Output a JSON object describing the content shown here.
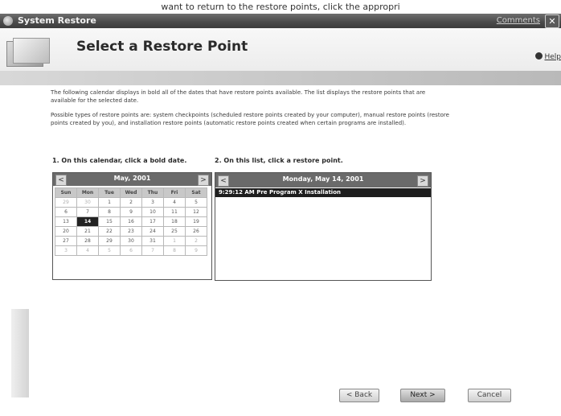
{
  "top_fragment": "want to return to the restore points, click the appropri",
  "window": {
    "title": "System Restore",
    "comments_link": "Comments",
    "close_glyph": "✕"
  },
  "header": {
    "page_title": "Select a Restore Point",
    "help_label": "Help"
  },
  "intro": {
    "para1": "The following calendar displays in bold all of the dates that have restore points available. The list displays the restore points that are available for the selected date.",
    "para2": "Possible types of restore points are: system checkpoints (scheduled restore points created by your computer), manual restore points (restore points created by you), and installation restore points (automatic restore points created when certain programs are installed)."
  },
  "steps": {
    "calendar_step": "1. On this calendar, click a bold date.",
    "list_step": "2. On this list, click a restore point."
  },
  "calendar": {
    "month_label": "May, 2001",
    "prev_glyph": "<",
    "next_glyph": ">",
    "weekdays": [
      "Sun",
      "Mon",
      "Tue",
      "Wed",
      "Thu",
      "Fri",
      "Sat"
    ],
    "weeks": [
      [
        "29",
        "30",
        "1",
        "2",
        "3",
        "4",
        "5"
      ],
      [
        "6",
        "7",
        "8",
        "9",
        "10",
        "11",
        "12"
      ],
      [
        "13",
        "14",
        "15",
        "16",
        "17",
        "18",
        "19"
      ],
      [
        "20",
        "21",
        "22",
        "23",
        "24",
        "25",
        "26"
      ],
      [
        "27",
        "28",
        "29",
        "30",
        "31",
        "1",
        "2"
      ],
      [
        "3",
        "4",
        "5",
        "6",
        "7",
        "8",
        "9"
      ]
    ],
    "selected_day": "14"
  },
  "restore_list": {
    "date_label": "Monday, May 14, 2001",
    "prev_glyph": "<",
    "next_glyph": ">",
    "items": [
      "9:29:12 AM Pre Program X Installation"
    ]
  },
  "buttons": {
    "back": "< Back",
    "next": "Next >",
    "cancel": "Cancel"
  }
}
